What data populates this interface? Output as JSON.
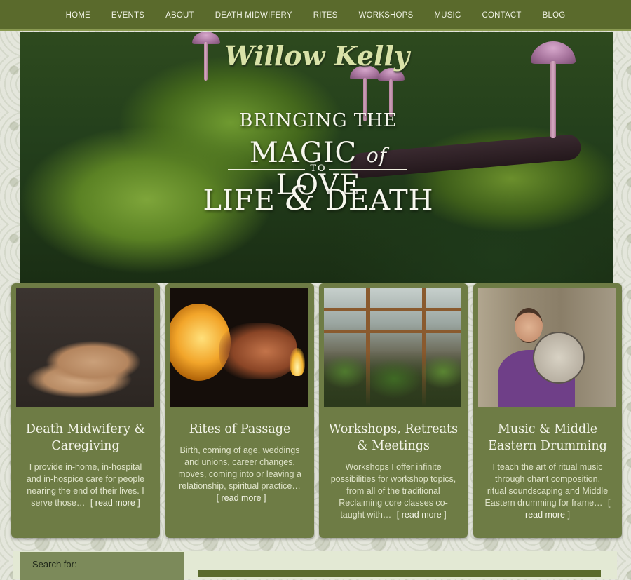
{
  "nav": {
    "items": [
      "HOME",
      "EVENTS",
      "ABOUT",
      "DEATH MIDWIFERY",
      "RITES",
      "WORKSHOPS",
      "MUSIC",
      "CONTACT",
      "BLOG"
    ]
  },
  "hero": {
    "logo": "Willow Kelly",
    "line1": "BRINGING THE",
    "line2a": "MAGIC",
    "line2b": "of",
    "line2c": "LOVE",
    "line3": "TO",
    "line4a": "LIFE",
    "line4b": "&",
    "line4c": "DEATH"
  },
  "cards": [
    {
      "title": "Death Midwifery & Caregiving",
      "desc": "I provide in-home, in-hospital and in-hospice care for people nearing the end of their lives. I serve those…",
      "read_more": "[ read more ]"
    },
    {
      "title": "Rites of Passage",
      "desc": "Birth, coming of age, weddings and unions, career changes, moves, coming into or leaving a relationship, spiritual practice…",
      "read_more": "[ read more ]"
    },
    {
      "title": "Workshops, Retreats & Meetings",
      "desc": "Workshops I offer infinite possibilities for workshop topics, from all of the traditional Reclaiming core classes co-taught with…",
      "read_more": "[ read more ]"
    },
    {
      "title": "Music & Middle Eastern Drumming",
      "desc": "I teach the art of ritual music through chant composition, ritual soundscaping and Middle Eastern drumming for frame…",
      "read_more": "[ read more ]"
    }
  ],
  "search": {
    "label": "Search for:"
  },
  "colors": {
    "nav_bg": "#5a6a2c",
    "card_bg": "#6e7c45",
    "text_light": "#f4f5ea"
  }
}
